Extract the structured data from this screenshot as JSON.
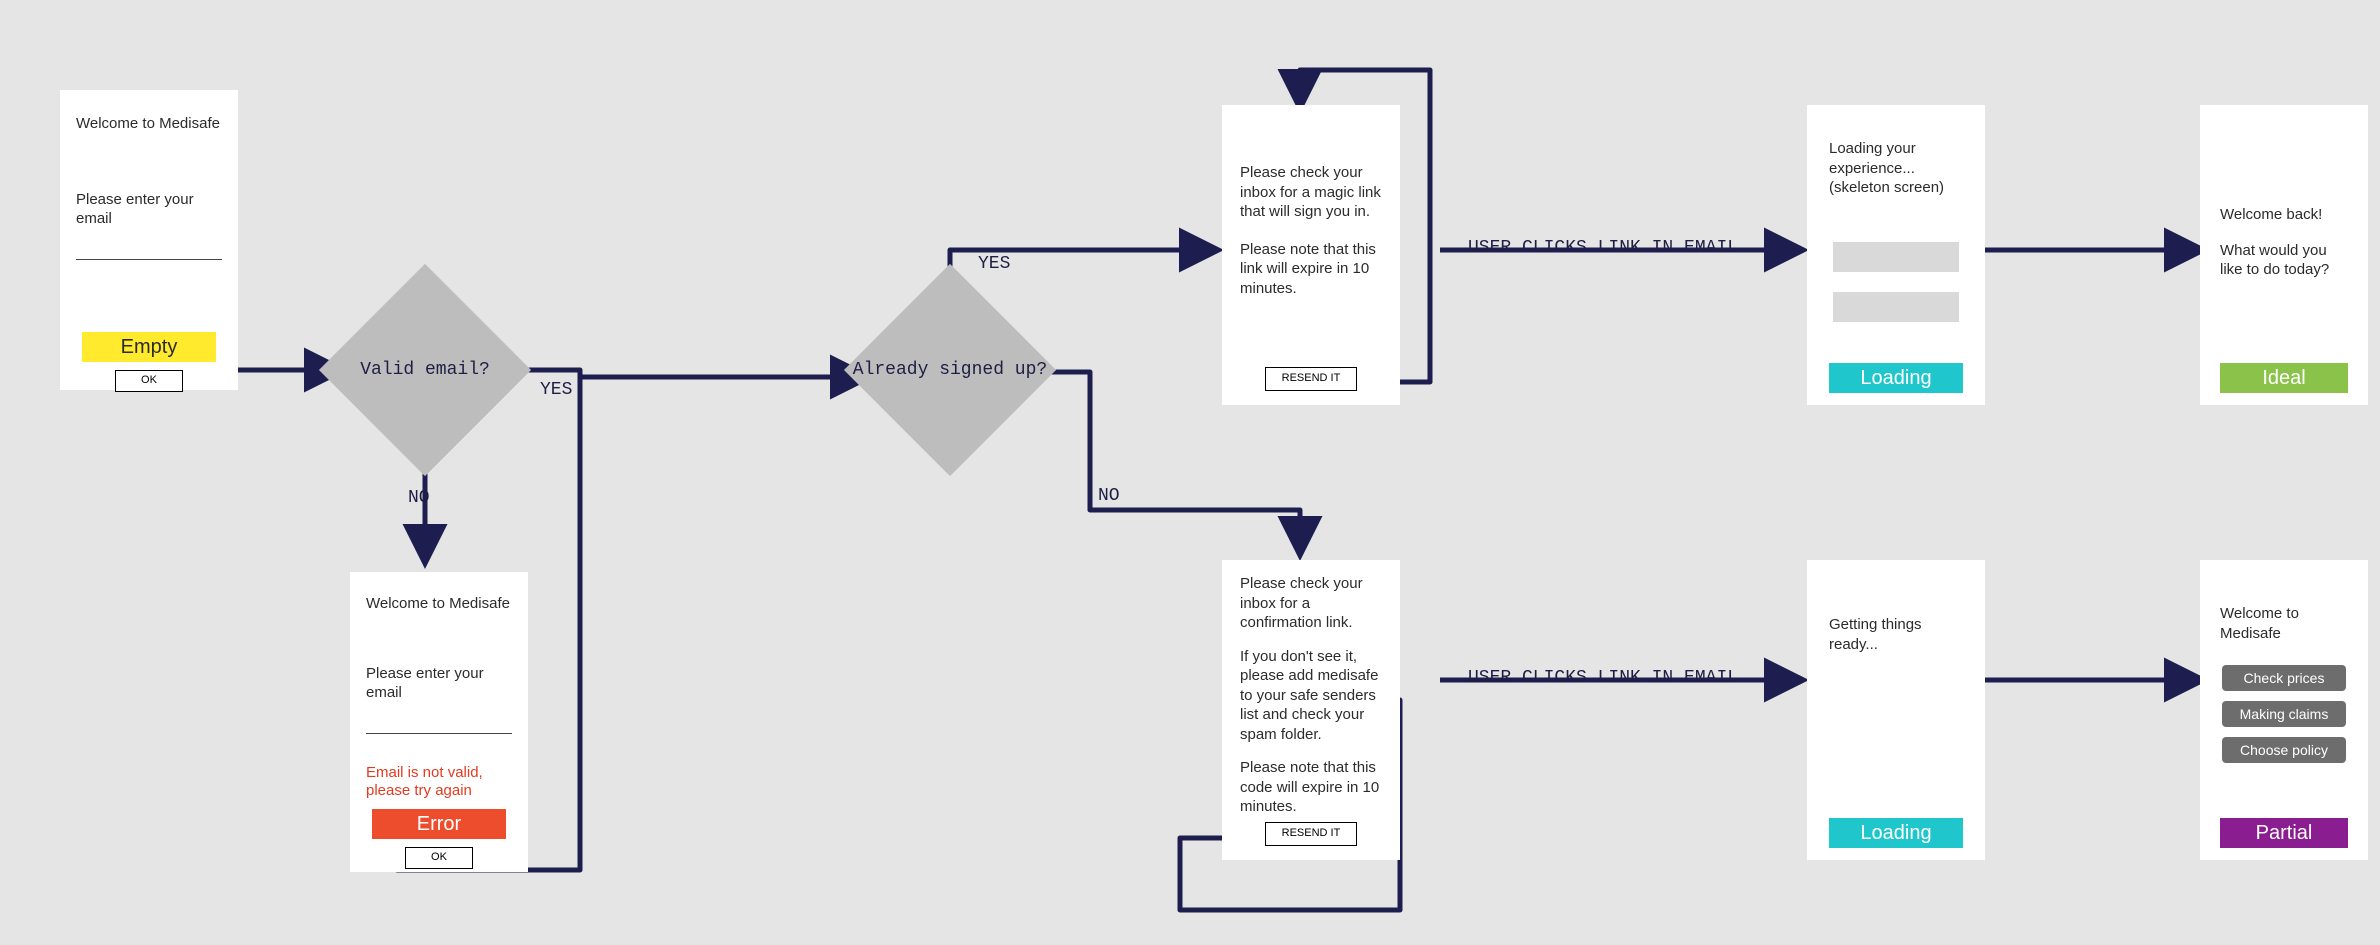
{
  "screen_empty": {
    "title": "Welcome to Medisafe",
    "prompt": "Please enter your email",
    "state": "Empty",
    "button": "OK"
  },
  "screen_error": {
    "title": "Welcome to Medisafe",
    "prompt": "Please enter your email",
    "error": "Email is not valid, please try again",
    "state": "Error",
    "button": "OK"
  },
  "decision_valid": {
    "label": "Valid email?"
  },
  "decision_signed": {
    "label": "Already signed up?"
  },
  "edges": {
    "no1": "NO",
    "yes1": "YES",
    "yes2": "YES",
    "no2": "NO",
    "link1": "USER CLICKS LINK IN EMAIL",
    "link2": "USER CLICKS LINK IN EMAIL"
  },
  "screen_magic": {
    "p1": "Please check your inbox for a magic link that will sign you in.",
    "p2": "Please note that this link will expire in 10 minutes.",
    "button": "RESEND IT"
  },
  "screen_confirm": {
    "p1": "Please check your inbox for a confirmation link.",
    "p2": "If you don't see it, please add medisafe to your safe senders list and check your spam folder.",
    "p3": "Please note that this code will expire in 10 minutes.",
    "button": "RESEND IT"
  },
  "screen_loading1": {
    "text": "Loading your experience... (skeleton screen)",
    "state": "Loading"
  },
  "screen_loading2": {
    "text": "Getting things ready...",
    "state": "Loading"
  },
  "screen_ideal": {
    "l1": "Welcome back!",
    "l2": "What would you like to do today?",
    "state": "Ideal"
  },
  "screen_partial": {
    "title": "Welcome to Medisafe",
    "b1": "Check prices",
    "b2": "Making claims",
    "b3": "Choose policy",
    "state": "Partial"
  }
}
